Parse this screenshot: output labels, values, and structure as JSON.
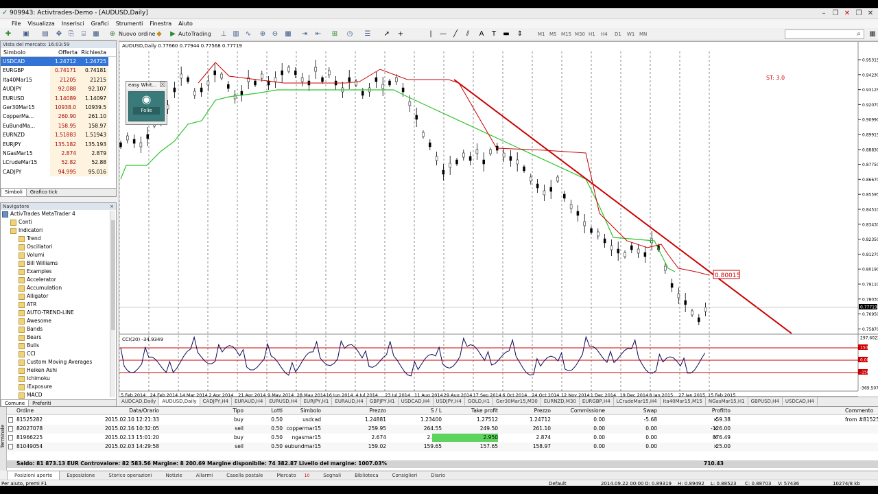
{
  "window": {
    "title": "909943: Activtrades-Demo - [AUDUSD,Daily]"
  },
  "menu": [
    "File",
    "Visualizza",
    "Inserisci",
    "Grafici",
    "Strumenti",
    "Finestra",
    "Aiuto"
  ],
  "toolbar": {
    "new_order": "Nuovo ordine",
    "autotrading": "AutoTrading",
    "timeframes": [
      "M1",
      "M5",
      "M15",
      "M30",
      "H1",
      "H4",
      "D1",
      "W1",
      "MN"
    ]
  },
  "market_watch": {
    "title": "Vista del mercato: 16:03:59",
    "headers": [
      "Simbolo",
      "Offerta",
      "Richiesta"
    ],
    "rows": [
      [
        "USDCAD",
        "1.24712",
        "1.24725"
      ],
      [
        "EURGBP",
        "0.74171",
        "0.74181"
      ],
      [
        "Ita40Mar15",
        "21205",
        "21215"
      ],
      [
        "AUDJPY",
        "92.088",
        "92.107"
      ],
      [
        "EURUSD",
        "1.14089",
        "1.14097"
      ],
      [
        "Ger30Mar15",
        "10938.0",
        "10939.5"
      ],
      [
        "CopperMa...",
        "260.90",
        "261.10"
      ],
      [
        "EuBundMa...",
        "158.95",
        "158.97"
      ],
      [
        "EURNZD",
        "1.51883",
        "1.51943"
      ],
      [
        "EURJPY",
        "135.182",
        "135.193"
      ],
      [
        "NGasMar15",
        "2.874",
        "2.879"
      ],
      [
        "LCrudeMar15",
        "52.82",
        "52.88"
      ],
      [
        "CADJPY",
        "94.995",
        "95.016"
      ]
    ],
    "tabs": [
      "Simboli",
      "Grafico tick"
    ]
  },
  "navigator": {
    "title": "Navigatore",
    "items": [
      "ActivTrades MetaTrader 4",
      "Conti",
      "Indicatori",
      "Trend",
      "Oscillatori",
      "Volumi",
      "Bill Williams",
      "Examples",
      "Accelerator",
      "Accumulation",
      "Alligator",
      "ATR",
      "AUTO-TREND-LINE",
      "Awesome",
      "Bands",
      "Bears",
      "Bulls",
      "CCI",
      "Custom Moving Averages",
      "Heiken Ashi",
      "Ichimoku",
      "iExposure",
      "MACD"
    ],
    "tabs": [
      "Comune",
      "Preferiti"
    ]
  },
  "chart": {
    "header": "AUDUSD,Daily  0.77660 0.77944 0.77568 0.77719",
    "st": "ST: 3.0",
    "price_label": "0.80015",
    "current_price": "0.77719",
    "price_ticks": [
      "0.95315",
      "0.94230",
      "0.93125",
      "0.92070",
      "0.90990",
      "0.89915",
      "0.88830",
      "0.87750",
      "0.86670",
      "0.85595",
      "0.84510",
      "0.83430",
      "0.82350",
      "0.81270",
      "0.80190",
      "0.79110",
      "0.78030",
      "0.76950",
      "0.75870"
    ],
    "cci_header": "CCI(20) -34.9349",
    "cci_ticks": [
      "297.6023",
      "150",
      "0.00",
      "-150",
      "-369.5076"
    ],
    "dates": [
      "5 Feb 2014",
      "24 Feb 2014",
      "14 Mar 2014",
      "2 Apr 2014",
      "21 Apr 2014",
      "9 May 2014",
      "28 May 2014",
      "16 Jun 2014",
      "4 Jul 2014",
      "23 Jul 2014",
      "11 Aug 2014",
      "29 Aug 2014",
      "17 Sep 2014",
      "6 Oct 2014",
      "24 Oct 2014",
      "12 Nov 2014",
      "1 Dec 2014",
      "19 Dec 2014",
      "8 Jan 2015",
      "27 Jan 2015",
      "15 Feb 2015"
    ],
    "ea": {
      "title": "easy Whit...",
      "button": "Folie"
    }
  },
  "chart_tabs": [
    "AUDCAD,Daily",
    "AUDUSD,Daily",
    "CADJPY,H4",
    "EURAUD,H4",
    "EURUSD,H4",
    "EURJPY,H1",
    "EURAUD,H4",
    "GBPJPY,H1",
    "USDCAD,H4",
    "USDJPY,H4",
    "GOLD,H1",
    "Ger30Mar15,M30",
    "EURNZD,M30",
    "EURGBP,H4",
    "LCrudeMar15,H4",
    "Ita40Mar15,M15",
    "NGasMar15,H1",
    "GBPUSD,H4",
    "USDCAD,H4"
  ],
  "terminal": {
    "headers": [
      "Ordine",
      "Data/Orario",
      "Tipo",
      "Lotti",
      "Simbolo",
      "Prezzo",
      "S / L",
      "Take profit",
      "Prezzo",
      "Commissione",
      "Swap",
      "Profitto",
      "Commento"
    ],
    "rows": [
      [
        "81525282",
        "2015.02.10 12:21:33",
        "buy",
        "0.50",
        "usdcad",
        "1.24881",
        "1.23400",
        "1.27512",
        "1.24712",
        "0.00",
        "-5.68",
        "-59.38",
        "from #81525104"
      ],
      [
        "82027078",
        "2015.02.16 10:32:05",
        "sell",
        "0.50",
        "coppermar15",
        "259.95",
        "264.55",
        "249.50",
        "261.10",
        "0.00",
        "0.00",
        "-126.00",
        ""
      ],
      [
        "81966225",
        "2015.02.13 15:01:20",
        "buy",
        "0.50",
        "ngasmar15",
        "2.674",
        "2.529",
        "2.950",
        "2.874",
        "0.00",
        "0.00",
        "876.49",
        ""
      ],
      [
        "81049054",
        "2015.02.03 14:29:58",
        "sell",
        "0.50",
        "eubundmar15",
        "159.02",
        "159.65",
        "157.65",
        "158.97",
        "0.00",
        "0.00",
        "25.00",
        ""
      ]
    ],
    "balance": "Saldo: 81 873.13 EUR  Controvalore: 82 583.56  Margine: 8 200.69  Margine disponibile: 74 382.87  Livello del margine: 1007.03%",
    "total": "710.43",
    "tabs": [
      "Posizioni aperte",
      "Esposizione",
      "Storico operazioni",
      "Notizie",
      "Allarmi",
      "Casella postale",
      "Mercato",
      "Segnali",
      "Biblioteca",
      "Consiglieri",
      "Diario"
    ],
    "market_badge": "10"
  },
  "status": {
    "help": "Per aiuto, premi F1",
    "profile": "Default",
    "time": "2014.09.22 00:00",
    "o": "O: 0.89319",
    "h": "H: 0.89492",
    "l": "L: 0.88523",
    "c": "C: 0.88703",
    "v": "V: 57436",
    "traffic": "10274/8 kb"
  },
  "colors": {
    "bull_line": "#2ec42e",
    "red": "#cc0000",
    "selected": "#3174d6"
  }
}
